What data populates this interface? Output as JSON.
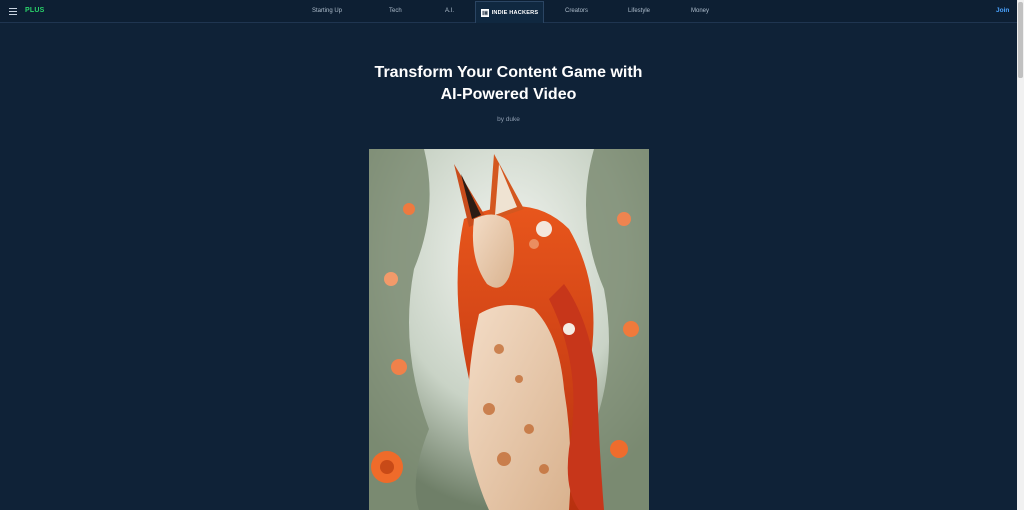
{
  "header": {
    "menu_icon": "hamburger-menu-icon",
    "plus_label": "PLUS",
    "nav": [
      "Starting Up",
      "Tech",
      "A.I.",
      "Creators",
      "Lifestyle",
      "Money"
    ],
    "logo_text": "INDIE HACKERS",
    "join_label": "Join"
  },
  "article": {
    "title_line1": "Transform Your Content Game with",
    "title_line2": "AI-Powered Video",
    "byline": "by duke",
    "hero_image": "illustration-fox-eared-woman-red-hair-floral"
  },
  "colors": {
    "background": "#0f2237",
    "plus": "#29d36a",
    "join": "#4aa3ff"
  }
}
